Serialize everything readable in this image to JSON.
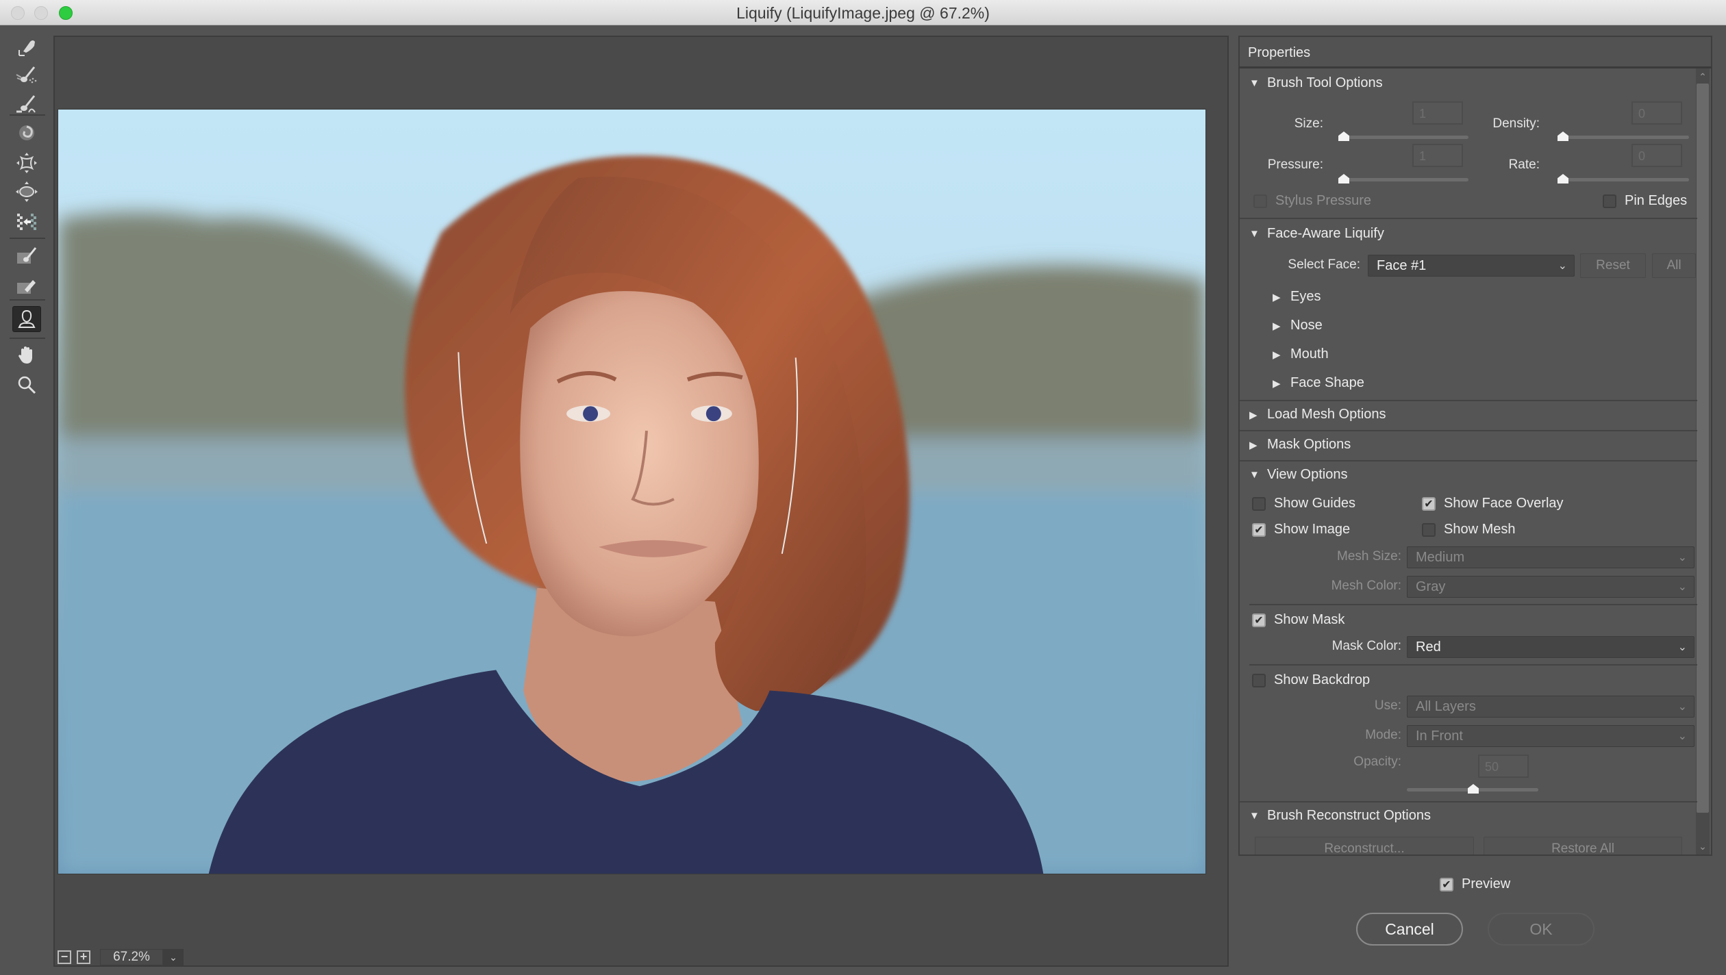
{
  "window": {
    "title": "Liquify (LiquifyImage.jpeg @ 67.2%)"
  },
  "tools": [
    {
      "name": "forward-warp-tool",
      "icon": "warp-hand-icon",
      "active": false
    },
    {
      "name": "reconstruct-tool",
      "icon": "reconstruct-brush-icon",
      "active": false
    },
    {
      "name": "smooth-tool",
      "icon": "smooth-brush-icon",
      "active": false
    },
    {
      "name": "twirl-clockwise-tool",
      "icon": "twirl-icon",
      "active": false
    },
    {
      "name": "pucker-tool",
      "icon": "pucker-icon",
      "active": false
    },
    {
      "name": "bloat-tool",
      "icon": "bloat-icon",
      "active": false
    },
    {
      "name": "push-left-tool",
      "icon": "push-left-icon",
      "active": false
    },
    {
      "name": "freeze-mask-tool",
      "icon": "freeze-mask-icon",
      "active": false
    },
    {
      "name": "thaw-mask-tool",
      "icon": "thaw-mask-icon",
      "active": false
    },
    {
      "name": "face-tool",
      "icon": "face-tool-icon",
      "active": true
    },
    {
      "name": "hand-tool",
      "icon": "hand-icon",
      "active": false
    },
    {
      "name": "zoom-tool",
      "icon": "zoom-icon",
      "active": false
    }
  ],
  "canvas": {
    "zoom_value": "67.2%",
    "zoom_out_label": "−",
    "zoom_in_label": "+"
  },
  "properties": {
    "title": "Properties",
    "brush_tool_options": {
      "header": "Brush Tool Options",
      "expanded": true,
      "size_label": "Size:",
      "size_value": "1",
      "density_label": "Density:",
      "density_value": "0",
      "pressure_label": "Pressure:",
      "pressure_value": "1",
      "rate_label": "Rate:",
      "rate_value": "0",
      "stylus_pressure_label": "Stylus Pressure",
      "stylus_pressure_checked": false,
      "pin_edges_label": "Pin Edges",
      "pin_edges_checked": false
    },
    "face_aware": {
      "header": "Face-Aware Liquify",
      "expanded": true,
      "select_face_label": "Select Face:",
      "select_face_value": "Face #1",
      "reset_label": "Reset",
      "all_label": "All",
      "subsections": [
        "Eyes",
        "Nose",
        "Mouth",
        "Face Shape"
      ]
    },
    "load_mesh_options": {
      "header": "Load Mesh Options",
      "expanded": false
    },
    "mask_options": {
      "header": "Mask Options",
      "expanded": false
    },
    "view_options": {
      "header": "View Options",
      "expanded": true,
      "show_guides_label": "Show Guides",
      "show_guides_checked": false,
      "show_face_overlay_label": "Show Face Overlay",
      "show_face_overlay_checked": true,
      "show_image_label": "Show Image",
      "show_image_checked": true,
      "show_mesh_label": "Show Mesh",
      "show_mesh_checked": false,
      "mesh_size_label": "Mesh Size:",
      "mesh_size_value": "Medium",
      "mesh_color_label": "Mesh Color:",
      "mesh_color_value": "Gray",
      "show_mask_label": "Show Mask",
      "show_mask_checked": true,
      "mask_color_label": "Mask Color:",
      "mask_color_value": "Red",
      "show_backdrop_label": "Show Backdrop",
      "show_backdrop_checked": false,
      "use_label": "Use:",
      "use_value": "All Layers",
      "mode_label": "Mode:",
      "mode_value": "In Front",
      "opacity_label": "Opacity:",
      "opacity_value": "50"
    },
    "brush_reconstruct": {
      "header": "Brush Reconstruct Options",
      "expanded": true,
      "reconstruct_label": "Reconstruct...",
      "restore_all_label": "Restore All"
    }
  },
  "footer": {
    "preview_label": "Preview",
    "preview_checked": true,
    "cancel_label": "Cancel",
    "ok_label": "OK"
  },
  "glyphs": {
    "triangle_down": "▼",
    "triangle_right": "▶",
    "chevron_down": "⌄",
    "chevron_up": "⌃",
    "check": "✔"
  }
}
